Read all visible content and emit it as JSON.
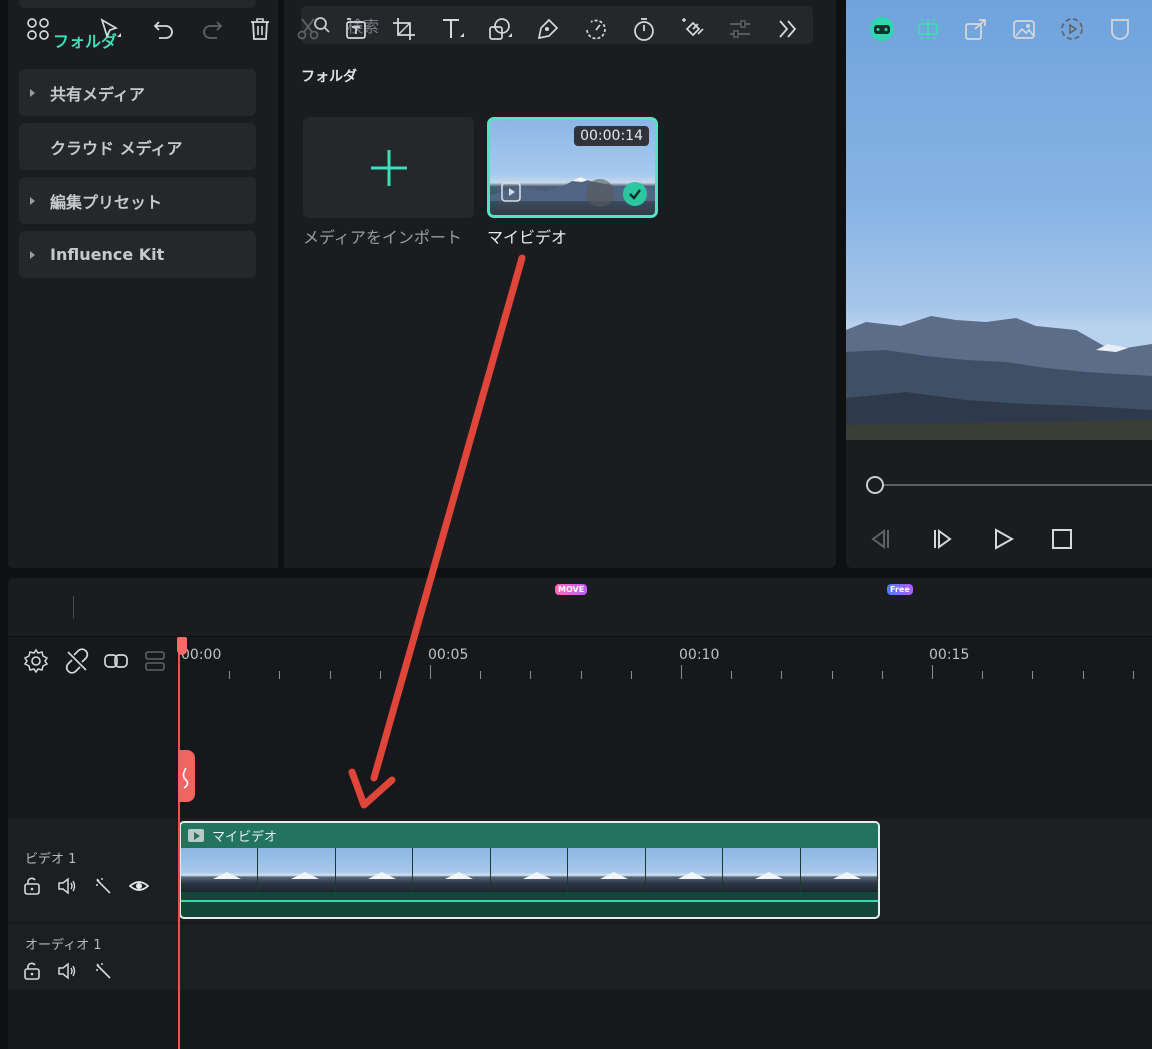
{
  "sidebar": {
    "active_folder": "フォルダ",
    "items": [
      {
        "label": "共有メディア",
        "expandable": true
      },
      {
        "label": "クラウド メディア",
        "expandable": false
      },
      {
        "label": "編集プリセット",
        "expandable": true
      },
      {
        "label": "Influence Kit",
        "expandable": true
      }
    ]
  },
  "media": {
    "search_placeholder": "検索",
    "section_heading": "フォルダ",
    "import_label": "メディアをインポート",
    "clip": {
      "name": "マイビデオ",
      "duration": "00:00:14",
      "selected": true
    }
  },
  "toolbar": {
    "badges": {
      "move": "MOVE",
      "free": "Free"
    },
    "icons": [
      "layout-icon",
      "select-tool-icon",
      "undo-icon",
      "redo-icon",
      "delete-icon",
      "cut-icon",
      "text-to-speech-icon",
      "crop-icon",
      "text-icon",
      "shape-icon",
      "pen-icon",
      "speed-icon",
      "timer-icon",
      "keyframe-icon",
      "adjust-icon",
      "more-icon",
      "ai-mate-icon",
      "auto-highlight-icon",
      "export-clip-icon",
      "image-icon",
      "reverse-icon",
      "shield-icon"
    ]
  },
  "timeline": {
    "ruler": [
      "00:00",
      "00:05",
      "00:10",
      "00:15"
    ],
    "tracks": [
      {
        "label": "ビデオ 1",
        "clip": "マイビデオ"
      },
      {
        "label": "オーディオ 1"
      }
    ]
  },
  "colors": {
    "accent": "#3fdcb8",
    "playhead": "#e8534f",
    "clip_header": "#22735f",
    "arrow": "#e0453a"
  }
}
